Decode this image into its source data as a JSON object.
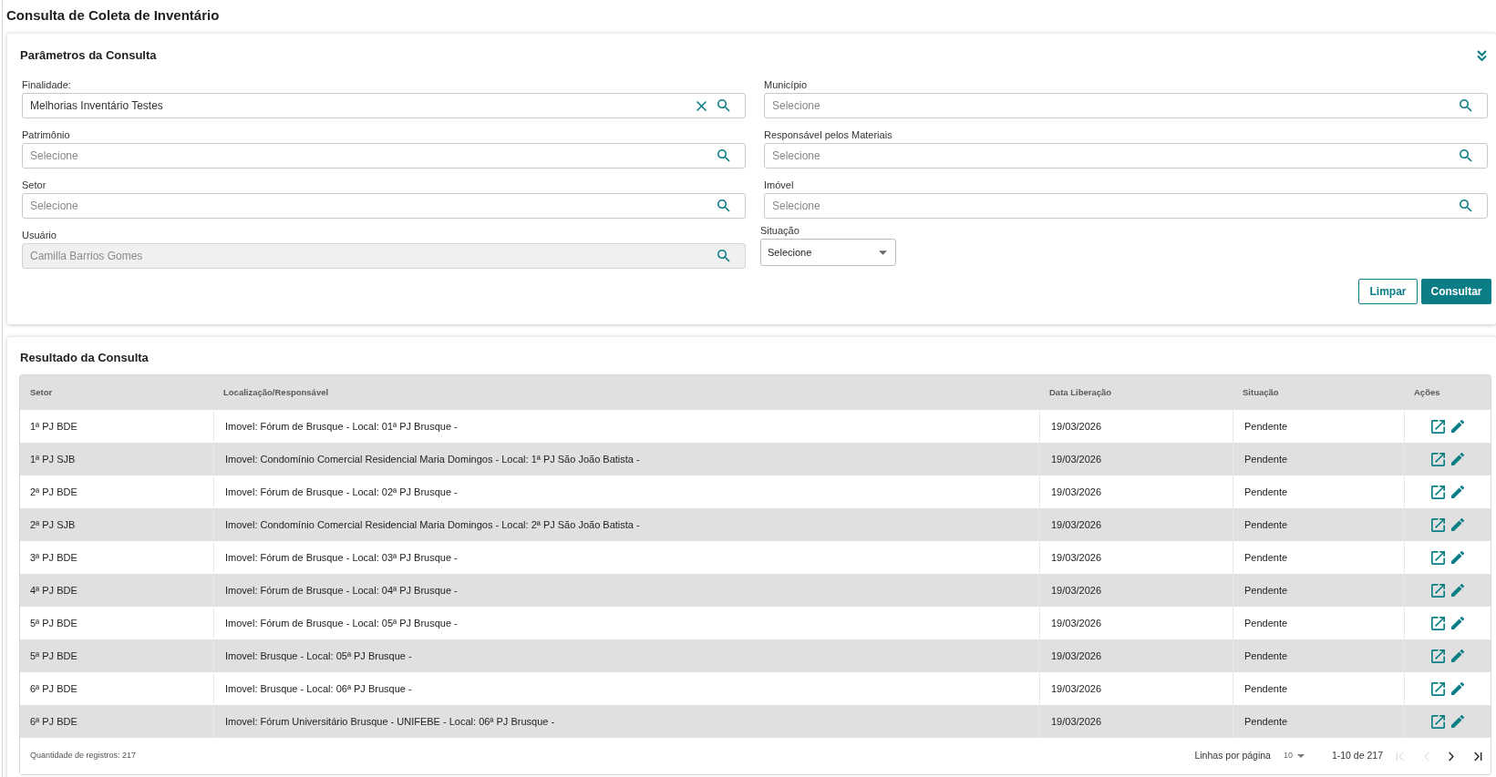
{
  "page_title": "Consulta de Coleta de Inventário",
  "parameters": {
    "title": "Parâmetros da Consulta",
    "left_fields": [
      {
        "label": "Finalidade:",
        "kind": "lookup",
        "value": "Melhorias Inventário Testes",
        "disabled": false
      },
      {
        "label": "Patrimônio",
        "kind": "lookup",
        "placeholder": "Selecione",
        "disabled": false
      },
      {
        "label": "Setor",
        "kind": "lookup",
        "placeholder": "Selecione",
        "disabled": false
      },
      {
        "label": "Usuário",
        "kind": "lookup",
        "value": "Camilla Barrios Gomes",
        "disabled": true
      }
    ],
    "right_fields": [
      {
        "label": "Município",
        "kind": "lookup",
        "placeholder": "Selecione",
        "disabled": false
      },
      {
        "label": "Responsável pelos Materiais",
        "kind": "lookup",
        "placeholder": "Selecione",
        "disabled": false
      },
      {
        "label": "Imóvel",
        "kind": "lookup",
        "placeholder": "Selecione",
        "disabled": false
      },
      {
        "label": "Situação",
        "kind": "select",
        "value": "Selecione",
        "disabled": false
      }
    ],
    "buttons": [
      {
        "label": "Limpar",
        "kind": "secondary"
      },
      {
        "label": "Consultar",
        "kind": "primary"
      }
    ]
  },
  "results": {
    "title": "Resultado da Consulta",
    "table": {
      "columns": [
        "Setor",
        "Localização/Responsável",
        "Data Liberação",
        "Situação",
        "Ações"
      ],
      "rows": [
        {
          "cells": [
            "1ª PJ BDE",
            "Imovel: Fórum de Brusque - Local: 01ª PJ Brusque -",
            "19/03/2026",
            "Pendente"
          ]
        },
        {
          "cells": [
            "1ª PJ SJB",
            "Imovel: Condomínio Comercial Residencial Maria Domingos - Local: 1ª PJ São João Batista -",
            "19/03/2026",
            "Pendente"
          ]
        },
        {
          "cells": [
            "2ª PJ BDE",
            "Imovel: Fórum de Brusque - Local: 02ª PJ Brusque -",
            "19/03/2026",
            "Pendente"
          ]
        },
        {
          "cells": [
            "2ª PJ SJB",
            "Imovel: Condomínio Comercial Residencial Maria Domingos - Local: 2ª PJ São João Batista -",
            "19/03/2026",
            "Pendente"
          ]
        },
        {
          "cells": [
            "3ª PJ BDE",
            "Imovel: Fórum de Brusque - Local: 03ª PJ Brusque -",
            "19/03/2026",
            "Pendente"
          ]
        },
        {
          "cells": [
            "4ª PJ BDE",
            "Imovel: Fórum de Brusque - Local: 04ª PJ Brusque -",
            "19/03/2026",
            "Pendente"
          ]
        },
        {
          "cells": [
            "5ª PJ BDE",
            "Imovel: Fórum de Brusque - Local: 05ª PJ Brusque -",
            "19/03/2026",
            "Pendente"
          ]
        },
        {
          "cells": [
            "5ª PJ BDE",
            "Imovel: Brusque - Local: 05ª PJ Brusque -",
            "19/03/2026",
            "Pendente"
          ]
        },
        {
          "cells": [
            "6ª PJ BDE",
            "Imovel: Brusque - Local: 06ª PJ Brusque -",
            "19/03/2026",
            "Pendente"
          ]
        },
        {
          "cells": [
            "6ª PJ BDE",
            "Imovel: Fórum Universitário Brusque - UNIFEBE - Local: 06ª PJ Brusque -",
            "19/03/2026",
            "Pendente"
          ]
        }
      ]
    },
    "footer": {
      "record_count": "Quantidade de registros: 217",
      "rows_per_page_label": "Linhas por página",
      "rows_per_page": "10",
      "range": "1-10 de 217",
      "nav_buttons": [
        {
          "kind": "first",
          "disabled": true
        },
        {
          "kind": "previous",
          "disabled": true
        },
        {
          "kind": "next",
          "disabled": false
        },
        {
          "kind": "last",
          "disabled": false
        }
      ]
    }
  }
}
